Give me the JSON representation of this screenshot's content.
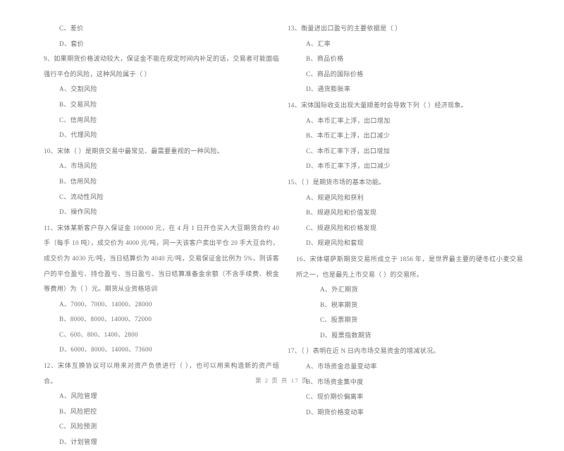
{
  "document": {
    "type": "exam-paper",
    "language": "zh-CN",
    "background_color": "#ffffff",
    "text_color": "#6f6f6f"
  },
  "footer": {
    "page_label": "第 2 页  共 17 页"
  },
  "left_column": {
    "orphan_options": [
      {
        "label": "C、差价"
      },
      {
        "label": "D、套价"
      }
    ],
    "questions": [
      {
        "number": "9",
        "stem": "9、如果期货价格波动较大，保证金不能在规定时间内补足的话，交易者可能面临强行平仓的风险，这种风险属于（      ）",
        "options": [
          {
            "label": "A、交割风险"
          },
          {
            "label": "B、交易风险"
          },
          {
            "label": "C、信用风险"
          },
          {
            "label": "D、代理风险"
          }
        ]
      },
      {
        "number": "10",
        "stem": "10、宋体（      ）是期货交易中最常见、最需要重视的一种风险。",
        "options": [
          {
            "label": "A、市场风险"
          },
          {
            "label": "B、信用风险"
          },
          {
            "label": "C、流动性风险"
          },
          {
            "label": "D、操作风险"
          }
        ]
      },
      {
        "number": "11",
        "stem": "11、宋体某新客户存入保证金 100000 元，在 4 月 1 日开仓买入大豆期货合约 40 手（每手 10 吨），成交价为 4000 元/吨，同一天该客户卖出平仓 20 手大豆合约，成交价为 4030 元/吨，当日结算价为 4040 元/吨，交易保证金比例为 5%，则该客户的平仓盈亏、持仓盈亏、当日盈亏、当日结算准备金余额（不含手续费、税金等费用）为（      ）元。期货从业资格培训",
        "options": [
          {
            "label": "A、7000、7000、14000、28000"
          },
          {
            "label": "B、8000、8000、14000、72000"
          },
          {
            "label": "C、600、800、1400、2800"
          },
          {
            "label": "D、6000、8000、14000、73600"
          }
        ]
      },
      {
        "number": "12",
        "stem": "12、宋体互换协议可以用来对资产负债进行（      ），也可以用来构造新的资产组合。",
        "options": [
          {
            "label": "A、风险管理"
          },
          {
            "label": "B、风险把控"
          },
          {
            "label": "C、风险预测"
          },
          {
            "label": "D、计划管理"
          }
        ]
      }
    ]
  },
  "right_column": {
    "questions": [
      {
        "number": "13",
        "stem": "13、衡量进出口盈亏的主要依据是（      ）",
        "options": [
          {
            "label": "A、汇率"
          },
          {
            "label": "B、商品价格"
          },
          {
            "label": "C、商品的国际价格"
          },
          {
            "label": "D、通货膨胀率"
          }
        ]
      },
      {
        "number": "14",
        "stem": "14、宋体国际收支出现大量顺差时会导致下列（      ）经济现象。",
        "options": [
          {
            "label": "A、本币汇率上浮，出口增加"
          },
          {
            "label": "B、本币汇率上浮，出口减少"
          },
          {
            "label": "C、本币汇率下浮，出口增加"
          },
          {
            "label": "D、本币汇率下浮，出口减少"
          }
        ]
      },
      {
        "number": "15",
        "stem": "15、（      ）是期货市场的基本功能。",
        "options": [
          {
            "label": "A、规避风险和获利"
          },
          {
            "label": "B、规避风险和价值发现"
          },
          {
            "label": "C、规避风险和价格发现"
          },
          {
            "label": "D、规避风险和套现"
          }
        ]
      },
      {
        "number": "16",
        "stem": "16、宋体堪萨斯期货交易所成立于 1856 年，是世界最主要的硬冬红小麦交易所之一，也是最先上市交易（      ）的交易所。",
        "options": [
          {
            "label": "A、外汇期货"
          },
          {
            "label": "B、税率期货"
          },
          {
            "label": "C、股票期货"
          },
          {
            "label": "D、股票指数期货"
          }
        ]
      },
      {
        "number": "17",
        "stem": "17、（      ）表明在近 N 日内市场交易资金的增减状况。",
        "options": [
          {
            "label": "A、市场资金总量变动率"
          },
          {
            "label": "B、市场资金集中度"
          },
          {
            "label": "C、现价期价偏离率"
          },
          {
            "label": "D、期货价格变动率"
          }
        ]
      }
    ]
  }
}
